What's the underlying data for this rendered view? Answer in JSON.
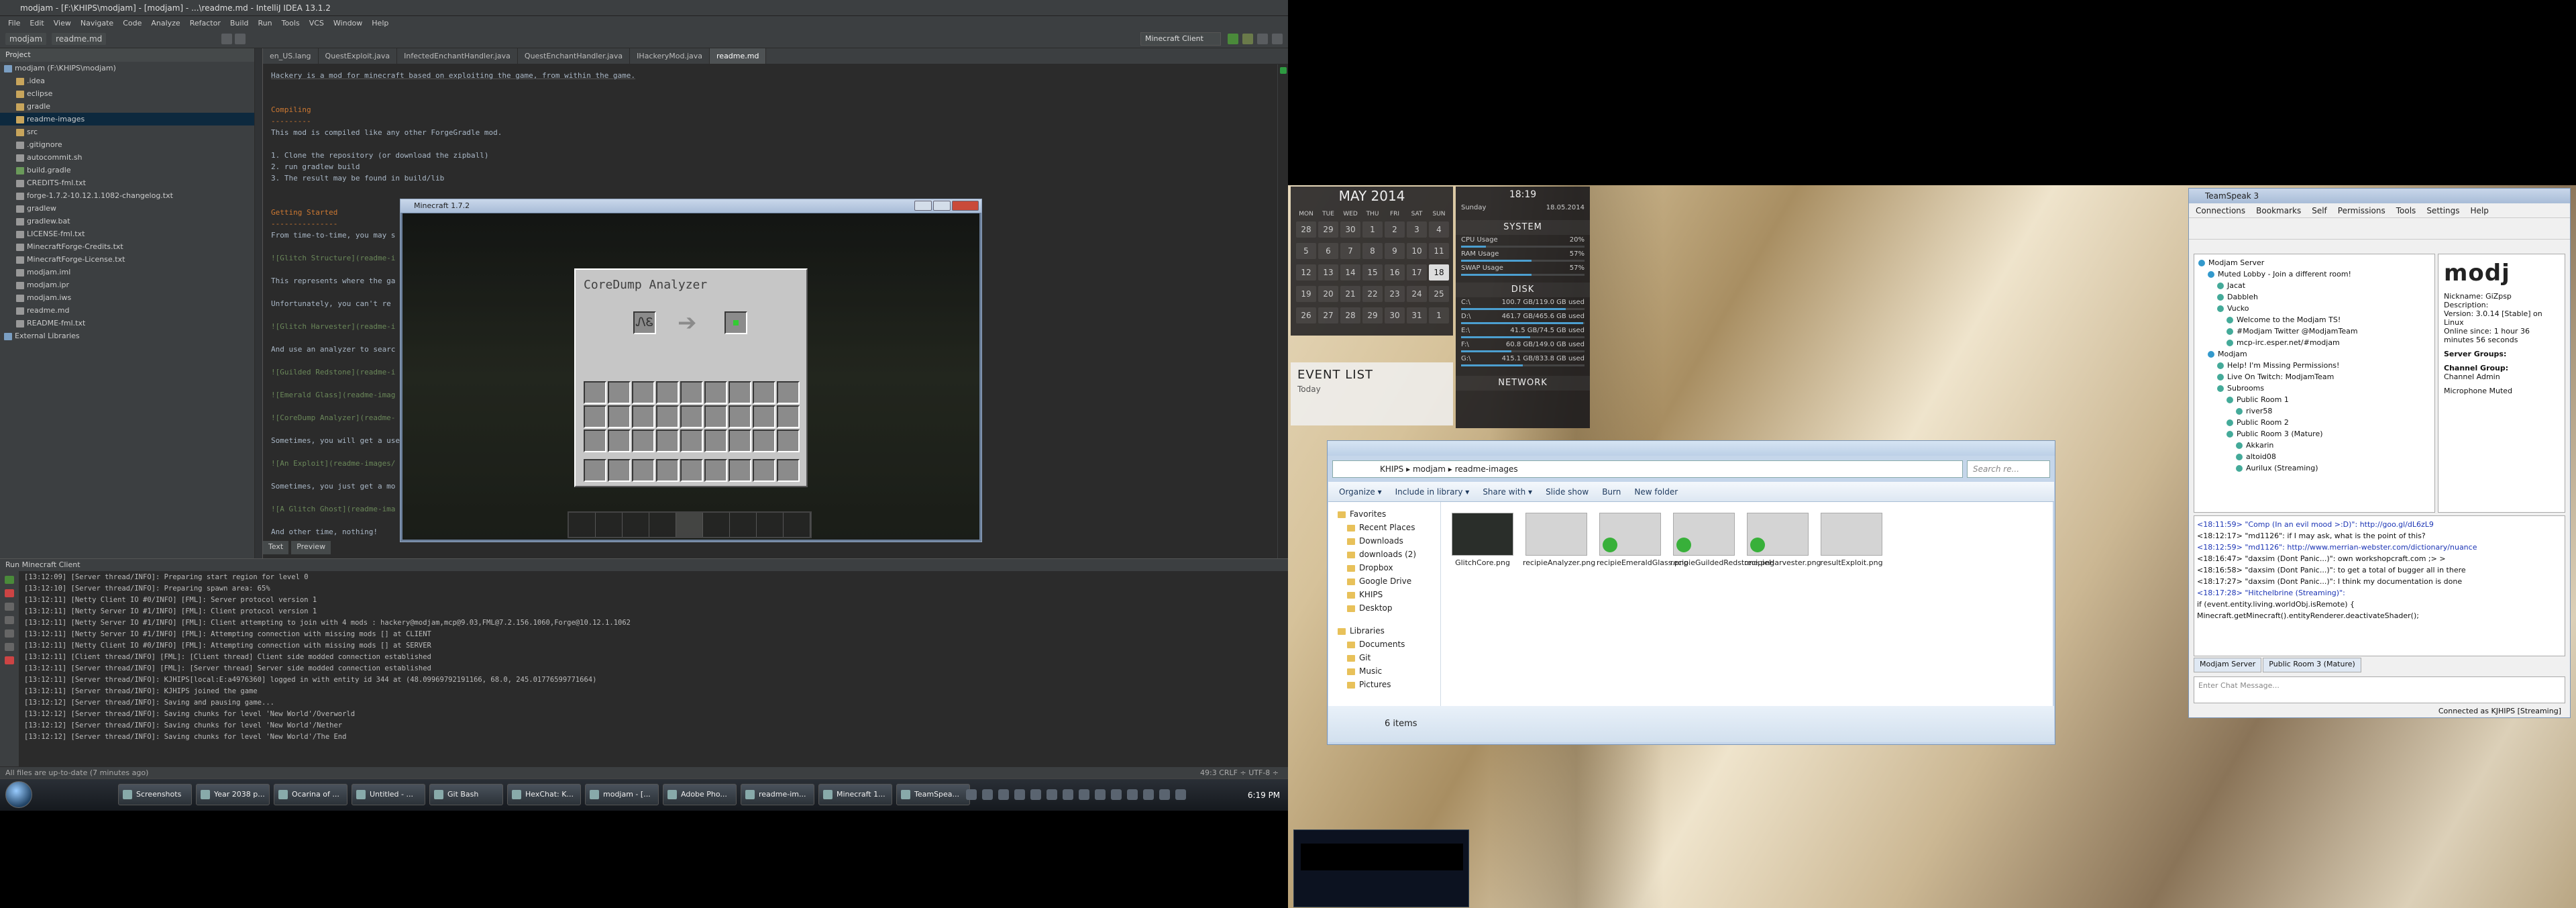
{
  "ide": {
    "title": "modjam - [F:\\KHIPS\\modjam] - [modjam] - ...\\readme.md - IntelliJ IDEA 13.1.2",
    "menu": [
      "File",
      "Edit",
      "View",
      "Navigate",
      "Code",
      "Analyze",
      "Refactor",
      "Build",
      "Run",
      "Tools",
      "VCS",
      "Window",
      "Help"
    ],
    "breadcrumbs": [
      "modjam",
      "readme.md"
    ],
    "run_config": "Minecraft Client",
    "project_header": "Project",
    "tree": [
      {
        "label": "modjam (F:\\KHIPS\\modjam)",
        "depth": 0,
        "color": "#7a9ec2"
      },
      {
        "label": ".idea",
        "depth": 1,
        "color": "#c8a55c"
      },
      {
        "label": "eclipse",
        "depth": 1,
        "color": "#c8a55c"
      },
      {
        "label": "gradle",
        "depth": 1,
        "color": "#c8a55c"
      },
      {
        "label": "readme-images",
        "depth": 1,
        "color": "#c8a55c",
        "selected": true
      },
      {
        "label": "src",
        "depth": 1,
        "color": "#c8a55c"
      },
      {
        "label": ".gitignore",
        "depth": 1,
        "color": "#999"
      },
      {
        "label": "autocommit.sh",
        "depth": 1,
        "color": "#999"
      },
      {
        "label": "build.gradle",
        "depth": 1,
        "color": "#6a9a5a"
      },
      {
        "label": "CREDITS-fml.txt",
        "depth": 1,
        "color": "#999"
      },
      {
        "label": "forge-1.7.2-10.12.1.1082-changelog.txt",
        "depth": 1,
        "color": "#999"
      },
      {
        "label": "gradlew",
        "depth": 1,
        "color": "#999"
      },
      {
        "label": "gradlew.bat",
        "depth": 1,
        "color": "#999"
      },
      {
        "label": "LICENSE-fml.txt",
        "depth": 1,
        "color": "#999"
      },
      {
        "label": "MinecraftForge-Credits.txt",
        "depth": 1,
        "color": "#999"
      },
      {
        "label": "MinecraftForge-License.txt",
        "depth": 1,
        "color": "#999"
      },
      {
        "label": "modjam.iml",
        "depth": 1,
        "color": "#999"
      },
      {
        "label": "modjam.ipr",
        "depth": 1,
        "color": "#999"
      },
      {
        "label": "modjam.iws",
        "depth": 1,
        "color": "#999"
      },
      {
        "label": "readme.md",
        "depth": 1,
        "color": "#999"
      },
      {
        "label": "README-fml.txt",
        "depth": 1,
        "color": "#999"
      },
      {
        "label": "External Libraries",
        "depth": 0,
        "color": "#7a9ec2"
      }
    ],
    "tabs": [
      {
        "label": "en_US.lang",
        "active": false
      },
      {
        "label": "QuestExploit.java",
        "active": false
      },
      {
        "label": "InfectedEnchantHandler.java",
        "active": false
      },
      {
        "label": "QuestEnchantHandler.java",
        "active": false
      },
      {
        "label": "IHackeryMod.java",
        "active": false
      },
      {
        "label": "readme.md",
        "active": true
      }
    ],
    "editor_lines": [
      {
        "t": "Hackery is a mod for minecraft based on exploiting the game, from within the game.",
        "k": "u"
      },
      {
        "t": "",
        "k": ""
      },
      {
        "t": "",
        "k": ""
      },
      {
        "t": "Compiling",
        "k": "h"
      },
      {
        "t": "---------",
        "k": "h"
      },
      {
        "t": "This mod is compiled like any other ForgeGradle mod.",
        "k": ""
      },
      {
        "t": "",
        "k": ""
      },
      {
        "t": "1. Clone the repository (or download the zipball)",
        "k": ""
      },
      {
        "t": "2. run gradlew build",
        "k": ""
      },
      {
        "t": "3. The result may be found in build/lib",
        "k": ""
      },
      {
        "t": "",
        "k": ""
      },
      {
        "t": "",
        "k": ""
      },
      {
        "t": "Getting Started",
        "k": "h"
      },
      {
        "t": "---------------",
        "k": "h"
      },
      {
        "t": "From time-to-time, you may s",
        "k": ""
      },
      {
        "t": "",
        "k": ""
      },
      {
        "t": "![Glitch Structure](readme-i",
        "k": "l"
      },
      {
        "t": "",
        "k": ""
      },
      {
        "t": "This represents where the ga",
        "k": ""
      },
      {
        "t": "",
        "k": ""
      },
      {
        "t": "Unfortunately, you can't re",
        "k": ""
      },
      {
        "t": "",
        "k": ""
      },
      {
        "t": "![Glitch Harvester](readme-i",
        "k": "l"
      },
      {
        "t": "",
        "k": ""
      },
      {
        "t": "And use an analyzer to searc",
        "k": ""
      },
      {
        "t": "",
        "k": ""
      },
      {
        "t": "![Guilded Redstone](readme-i",
        "k": "l"
      },
      {
        "t": "",
        "k": ""
      },
      {
        "t": "![Emerald Glass](readme-imag",
        "k": "l"
      },
      {
        "t": "",
        "k": ""
      },
      {
        "t": "![CoreDump Analyzer](readme-",
        "k": "l"
      },
      {
        "t": "",
        "k": ""
      },
      {
        "t": "Sometimes, you will get a use",
        "k": ""
      },
      {
        "t": "",
        "k": ""
      },
      {
        "t": "![An Exploit](readme-images/",
        "k": "l"
      },
      {
        "t": "",
        "k": ""
      },
      {
        "t": "Sometimes, you just get a mo",
        "k": ""
      },
      {
        "t": "",
        "k": ""
      },
      {
        "t": "![A Glitch Ghost](readme-ima",
        "k": "l"
      },
      {
        "t": "",
        "k": ""
      },
      {
        "t": "And other time, nothing!",
        "k": ""
      }
    ],
    "preview_tabs": [
      "Text",
      "Preview"
    ],
    "run_header": "Run  Minecraft Client",
    "console": [
      "[13:12:09] [Server thread/INFO]: Preparing start region for level 0",
      "[13:12:10] [Server thread/INFO]: Preparing spawn area: 65%",
      "[13:12:11] [Netty Client IO #0/INFO] [FML]: Server protocol version 1",
      "[13:12:11] [Netty Server IO #1/INFO] [FML]: Client protocol version 1",
      "[13:12:11] [Netty Server IO #1/INFO] [FML]: Client attempting to join with 4 mods : hackery@modjam,mcp@9.03,FML@7.2.156.1060,Forge@10.12.1.1062",
      "[13:12:11] [Netty Server IO #1/INFO] [FML]: Attempting connection with missing mods [] at CLIENT",
      "[13:12:11] [Netty Client IO #0/INFO] [FML]: Attempting connection with missing mods [] at SERVER",
      "[13:12:11] [Client thread/INFO] [FML]: [Client thread] Client side modded connection established",
      "[13:12:11] [Server thread/INFO] [FML]: [Server thread] Server side modded connection established",
      "[13:12:11] [Server thread/INFO]: KJHIPS[local:E:a4976360] logged in with entity id 344 at (48.09969792191166, 68.0, 245.01776599771664)",
      "[13:12:11] [Server thread/INFO]: KJHIPS joined the game",
      "[13:12:12] [Server thread/INFO]: Saving and pausing game...",
      "[13:12:12] [Server thread/INFO]: Saving chunks for level 'New World'/Overworld",
      "[13:12:12] [Server thread/INFO]: Saving chunks for level 'New World'/Nether",
      "[13:12:12] [Server thread/INFO]: Saving chunks for level 'New World'/The End"
    ],
    "status_left": "All files are up-to-date (7 minutes ago)",
    "status_right": "49:3   CRLF ÷   UTF-8 ÷"
  },
  "minecraft": {
    "title": "Minecraft 1.7.2",
    "gui_title": "CoreDump Analyzer",
    "input_glyph": "ᏁᏋ"
  },
  "taskbar": {
    "items": [
      "Screenshots",
      "Year 2038 p...",
      "Ocarina of ...",
      "Untitled - ...",
      "Git Bash",
      "HexChat: K...",
      "modjam - [...",
      "Adobe Pho...",
      "readme-im...",
      "Minecraft 1...",
      "TeamSpea..."
    ],
    "clock": "6:19 PM"
  },
  "desktop": {
    "calendar": {
      "month": "MAY 2014",
      "weekdays": [
        "MON",
        "TUE",
        "WED",
        "THU",
        "FRI",
        "SAT",
        "SUN"
      ],
      "days": [
        "28",
        "29",
        "30",
        "1",
        "2",
        "3",
        "4",
        "5",
        "6",
        "7",
        "8",
        "9",
        "10",
        "11",
        "12",
        "13",
        "14",
        "15",
        "16",
        "17",
        "18",
        "19",
        "20",
        "21",
        "22",
        "23",
        "24",
        "25",
        "26",
        "27",
        "28",
        "29",
        "30",
        "31",
        "1"
      ]
    },
    "clockwidget": {
      "time": "18:19",
      "day": "Sunday",
      "date": "18.05.2014"
    },
    "system": {
      "title": "SYSTEM",
      "rows": [
        {
          "label": "CPU Usage",
          "value": "20%",
          "pct": 20
        },
        {
          "label": "RAM Usage",
          "value": "57%",
          "pct": 57
        },
        {
          "label": "SWAP Usage",
          "value": "57%",
          "pct": 57
        }
      ]
    },
    "disk": {
      "title": "DISK",
      "rows": [
        {
          "label": "C:\\",
          "value": "100.7 GB/119.0 GB used",
          "pct": 85
        },
        {
          "label": "D:\\",
          "value": "461.7 GB/465.6 GB used",
          "pct": 99
        },
        {
          "label": "E:\\",
          "value": "41.5 GB/74.5 GB used",
          "pct": 56
        },
        {
          "label": "F:\\",
          "value": "60.8 GB/149.0 GB used",
          "pct": 41
        },
        {
          "label": "G:\\",
          "value": "415.1 GB/833.8 GB used",
          "pct": 50
        }
      ]
    },
    "network_title": "NETWORK",
    "events": {
      "title": "EVENT LIST",
      "today": "Today"
    }
  },
  "explorer": {
    "path": "KHIPS ▸ modjam ▸ readme-images",
    "search": "Search re...",
    "commands": [
      "Organize ▾",
      "Include in library ▾",
      "Share with ▾",
      "Slide show",
      "Burn",
      "New folder"
    ],
    "nav": [
      {
        "label": "Favorites",
        "sub": false
      },
      {
        "label": "Recent Places",
        "sub": true
      },
      {
        "label": "Downloads",
        "sub": true
      },
      {
        "label": "downloads (2)",
        "sub": true
      },
      {
        "label": "Dropbox",
        "sub": true
      },
      {
        "label": "Google Drive",
        "sub": true
      },
      {
        "label": "KHIPS",
        "sub": true
      },
      {
        "label": "Desktop",
        "sub": true
      },
      {
        "label": "Libraries",
        "sub": false
      },
      {
        "label": "Documents",
        "sub": true
      },
      {
        "label": "Git",
        "sub": true
      },
      {
        "label": "Music",
        "sub": true
      },
      {
        "label": "Pictures",
        "sub": true
      }
    ],
    "files": [
      {
        "label": "GlitchCore.png",
        "check": false
      },
      {
        "label": "recipieAnalyzer.png",
        "check": false
      },
      {
        "label": "recipieEmeraldGlass.png",
        "check": true
      },
      {
        "label": "recipieGuildedRedstone.png",
        "check": true
      },
      {
        "label": "recipieHarvester.png",
        "check": true
      },
      {
        "label": "resultExploit.png",
        "check": false
      }
    ],
    "count": "6 items"
  },
  "teamspeak": {
    "title": "TeamSpeak 3",
    "menu": [
      "Connections",
      "Bookmarks",
      "Self",
      "Permissions",
      "Tools",
      "Settings",
      "Help"
    ],
    "tree": [
      {
        "label": "Modjam Server",
        "depth": 0
      },
      {
        "label": "Muted Lobby - Join a different room!",
        "depth": 1
      },
      {
        "label": "Jacat",
        "depth": 2
      },
      {
        "label": "Dabbleh",
        "depth": 2
      },
      {
        "label": "Vucko",
        "depth": 2
      },
      {
        "label": "Welcome to the Modjam TS!",
        "depth": 3
      },
      {
        "label": "#Modjam Twitter @ModjamTeam",
        "depth": 3
      },
      {
        "label": "mcp-irc.esper.net/#modjam",
        "depth": 3
      },
      {
        "label": "Modjam",
        "depth": 1
      },
      {
        "label": "Help! I'm Missing Permissions!",
        "depth": 2
      },
      {
        "label": "Live On Twitch: ModjamTeam",
        "depth": 2
      },
      {
        "label": "Subrooms",
        "depth": 2
      },
      {
        "label": "Public Room 1",
        "depth": 3
      },
      {
        "label": "river58",
        "depth": 4
      },
      {
        "label": "Public Room 2",
        "depth": 3
      },
      {
        "label": "Public Room 3 (Mature)",
        "depth": 3
      },
      {
        "label": "Akkarin",
        "depth": 4
      },
      {
        "label": "altoid08",
        "depth": 4
      },
      {
        "label": "Aurilux (Streaming)",
        "depth": 4
      }
    ],
    "info": {
      "nickname": "Nickname: GiZpsp",
      "description": "Description:",
      "version": "Version: 3.0.14 [Stable] on Linux",
      "online": "Online since: 1 hour 36 minutes 56 seconds",
      "groups": "Server Groups:",
      "channel_group": "Channel Group:",
      "channel_admin": "Channel Admin",
      "mic": "Microphone Muted"
    },
    "chat": [
      {
        "t": "<18:11:59> \"Comp (In an evil mood >:D)\": http://goo.gl/dL6zL9",
        "a": true
      },
      {
        "t": "<18:12:17> \"md1126\": if I may ask, what is the point of this?",
        "a": false
      },
      {
        "t": "<18:12:59> \"md1126\": http://www.merrian-webster.com/dictionary/nuance",
        "a": true
      },
      {
        "t": "<18:16:47> \"daxsim (Dont Panic...)\": own workshopcraft.com ;> >",
        "a": false
      },
      {
        "t": "<18:16:58> \"daxsim (Dont Panic...)\": to get a total of bugger all in there",
        "a": false
      },
      {
        "t": "<18:17:27> \"daxsim (Dont Panic...)\": I think my documentation is done",
        "a": false
      },
      {
        "t": "<18:17:28> \"Hitchelbrine (Streaming)\":",
        "a": true
      },
      {
        "t": "    if (event.entity.living.worldObj.isRemote) {",
        "a": false
      },
      {
        "t": "        Minecraft.getMinecraft().entityRenderer.deactivateShader();",
        "a": false
      }
    ],
    "chat_tabs": [
      "Modjam Server",
      "Public Room 3 (Mature)"
    ],
    "input_placeholder": "Enter Chat Message...",
    "status": "Connected as KJHIPS [Streaming]"
  }
}
